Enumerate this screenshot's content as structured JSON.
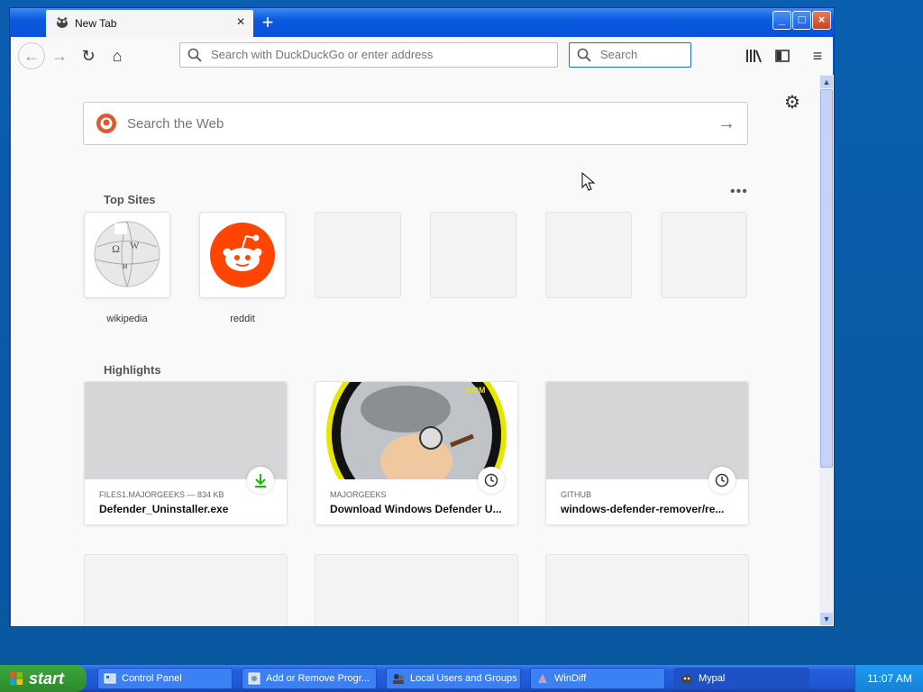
{
  "window": {
    "tab_title": "New Tab",
    "new_tab_symbol": "+",
    "tab_close_symbol": "×",
    "controls": {
      "minimize": "_",
      "maximize": "□",
      "close": "×"
    }
  },
  "toolbar": {
    "url_placeholder": "Search with DuckDuckGo or enter address",
    "search_placeholder": "Search",
    "icons": [
      "back-arrow-icon",
      "forward-arrow-icon",
      "reload-icon",
      "home-icon",
      "library-icon",
      "sidebar-icon",
      "hamburger-menu-icon"
    ]
  },
  "newtab": {
    "web_search_placeholder": "Search the Web",
    "top_sites_title": "Top Sites",
    "top_sites": [
      {
        "label": "wikipedia"
      },
      {
        "label": "reddit"
      }
    ],
    "highlights_title": "Highlights",
    "highlights": [
      {
        "context": "FILES1.MAJORGEEKS — 834 KB",
        "title": "Defender_Uninstaller.exe",
        "badge": "download-icon"
      },
      {
        "context": "MAJORGEEKS",
        "title": "Download Windows Defender U...",
        "badge": "clock-icon"
      },
      {
        "context": "GITHUB",
        "title": "windows-defender-remover/re...",
        "badge": "clock-icon"
      }
    ]
  },
  "taskbar": {
    "start_label": "start",
    "tasks": [
      {
        "label": "Control Panel"
      },
      {
        "label": "Add or Remove Progr..."
      },
      {
        "label": "Local Users and Groups"
      },
      {
        "label": "WinDiff"
      },
      {
        "label": "Mypal"
      }
    ],
    "clock": "11:07 AM"
  },
  "colors": {
    "accent": "#0a5ae0",
    "reddit": "#ff4500",
    "download_green": "#12bc00"
  }
}
